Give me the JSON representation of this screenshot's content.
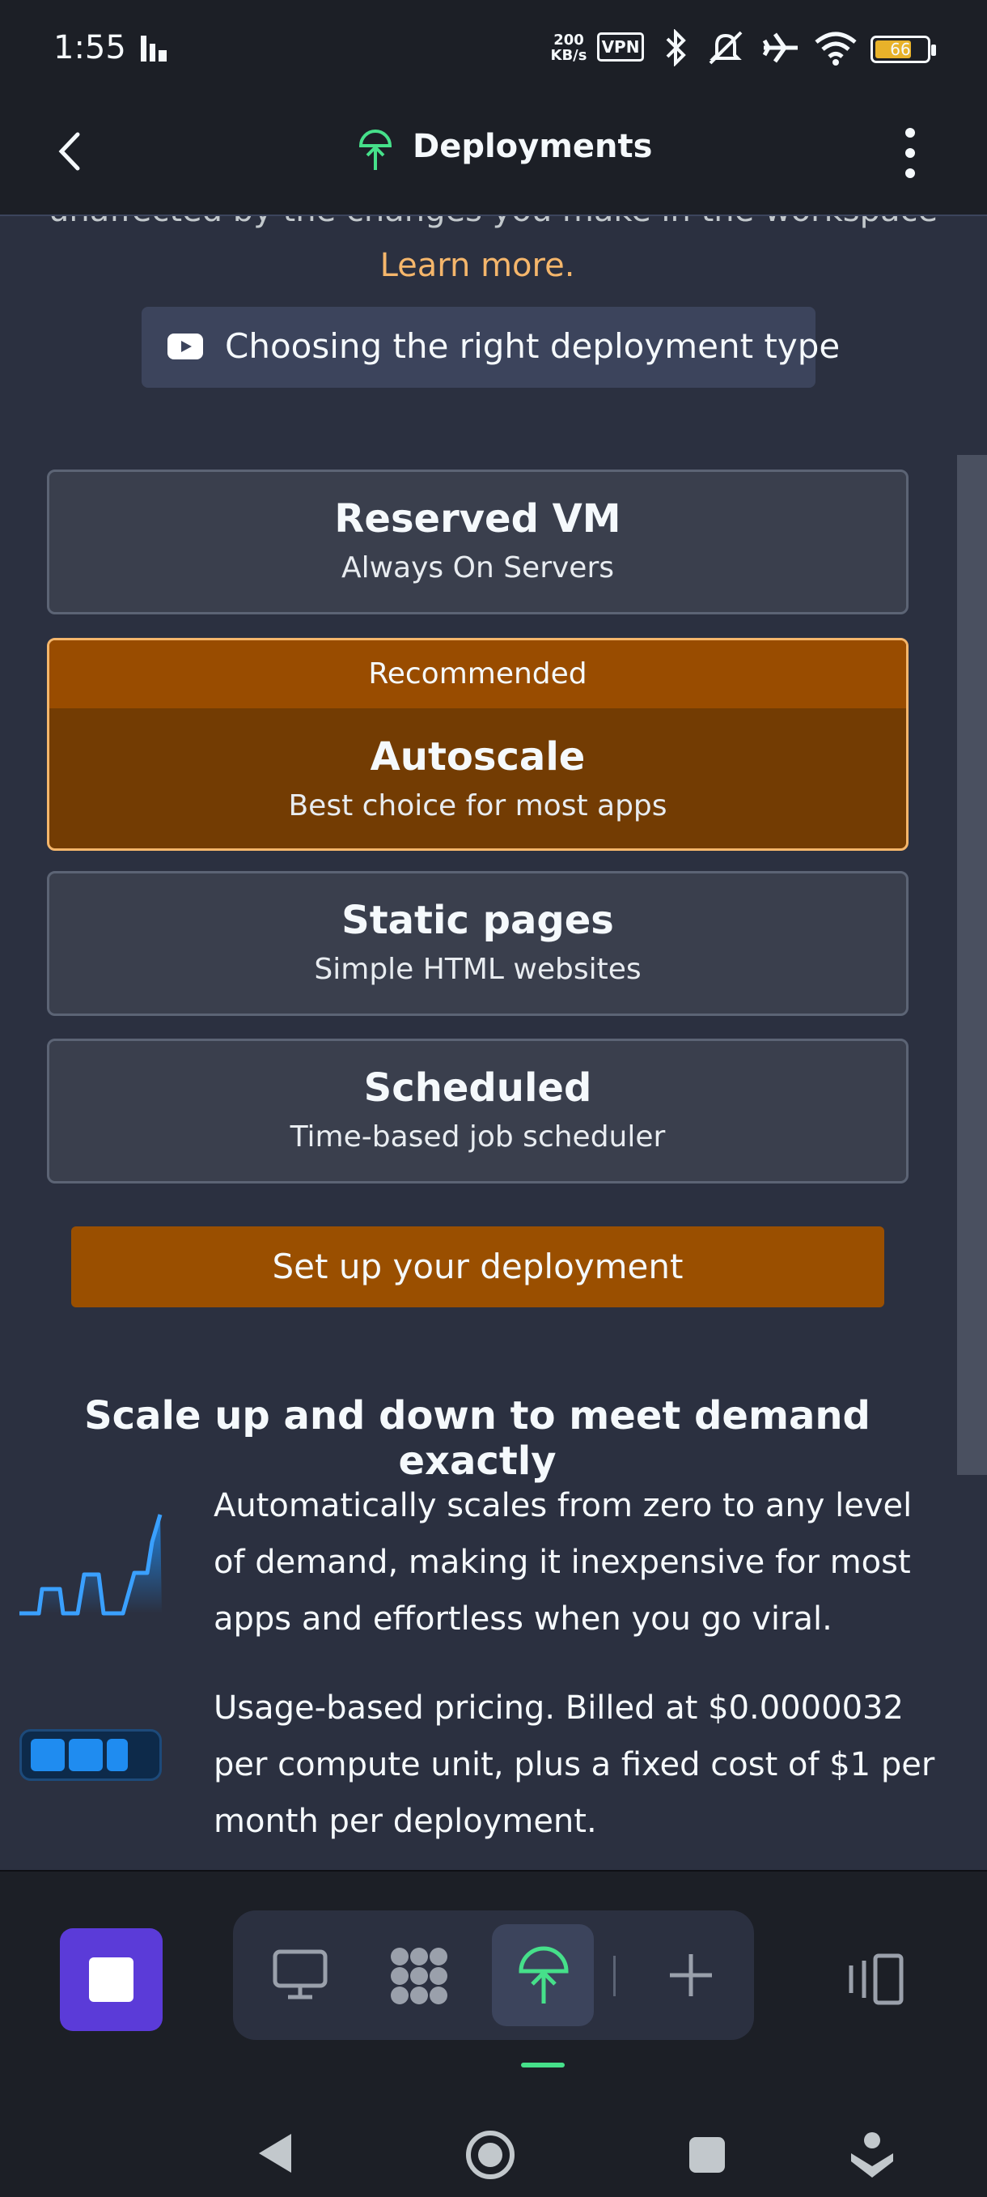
{
  "status_bar": {
    "time": "1:55",
    "network_speed_top": "200",
    "network_speed_bottom": "KB/s",
    "vpn": "VPN",
    "battery": "66",
    "icons": [
      "signal-bars-icon",
      "bluetooth-icon",
      "mute-icon",
      "airplane-icon",
      "wifi-icon",
      "battery-icon"
    ]
  },
  "header": {
    "title": "Deployments",
    "icons": [
      "back-icon",
      "deployments-icon",
      "more-vertical-icon"
    ]
  },
  "intro": {
    "truncated_text": "unaffected by the changes you make in the workspace",
    "learn_more": "Learn more.",
    "video_button_label": "Choosing the right deployment type"
  },
  "deployment_types": [
    {
      "title": "Reserved VM",
      "subtitle": "Always On Servers",
      "selected": false
    },
    {
      "badge": "Recommended",
      "title": "Autoscale",
      "subtitle": "Best choice for most apps",
      "selected": true
    },
    {
      "title": "Static pages",
      "subtitle": "Simple HTML websites",
      "selected": false
    },
    {
      "title": "Scheduled",
      "subtitle": "Time-based job scheduler",
      "selected": false
    }
  ],
  "cta_label": "Set up your deployment",
  "features": {
    "heading": "Scale up and down to meet demand exactly",
    "items": [
      {
        "icon": "scaling-graph-icon",
        "text": "Automatically scales from zero to any level of demand, making it inexpensive for most apps and effortless when you go viral."
      },
      {
        "icon": "usage-meter-icon",
        "text": "Usage-based pricing. Billed at $0.0000032 per compute unit, plus a fixed cost of $1 per month per deployment."
      }
    ]
  },
  "bottom_bar": {
    "tabs": [
      "stop-icon",
      "desktop-icon",
      "console-icon",
      "deployments-icon",
      "add-tab-icon",
      "device-toggle-icon"
    ],
    "active_tab": "deployments-icon"
  },
  "nav_bar": [
    "nav-back-icon",
    "nav-home-icon",
    "nav-recents-icon",
    "nav-assistant-icon"
  ],
  "colors": {
    "background": "#2b3040",
    "accent": "#9a4f00",
    "selected_card": "#733c03",
    "link": "#f5b66b",
    "active_indicator": "#46e08a"
  }
}
